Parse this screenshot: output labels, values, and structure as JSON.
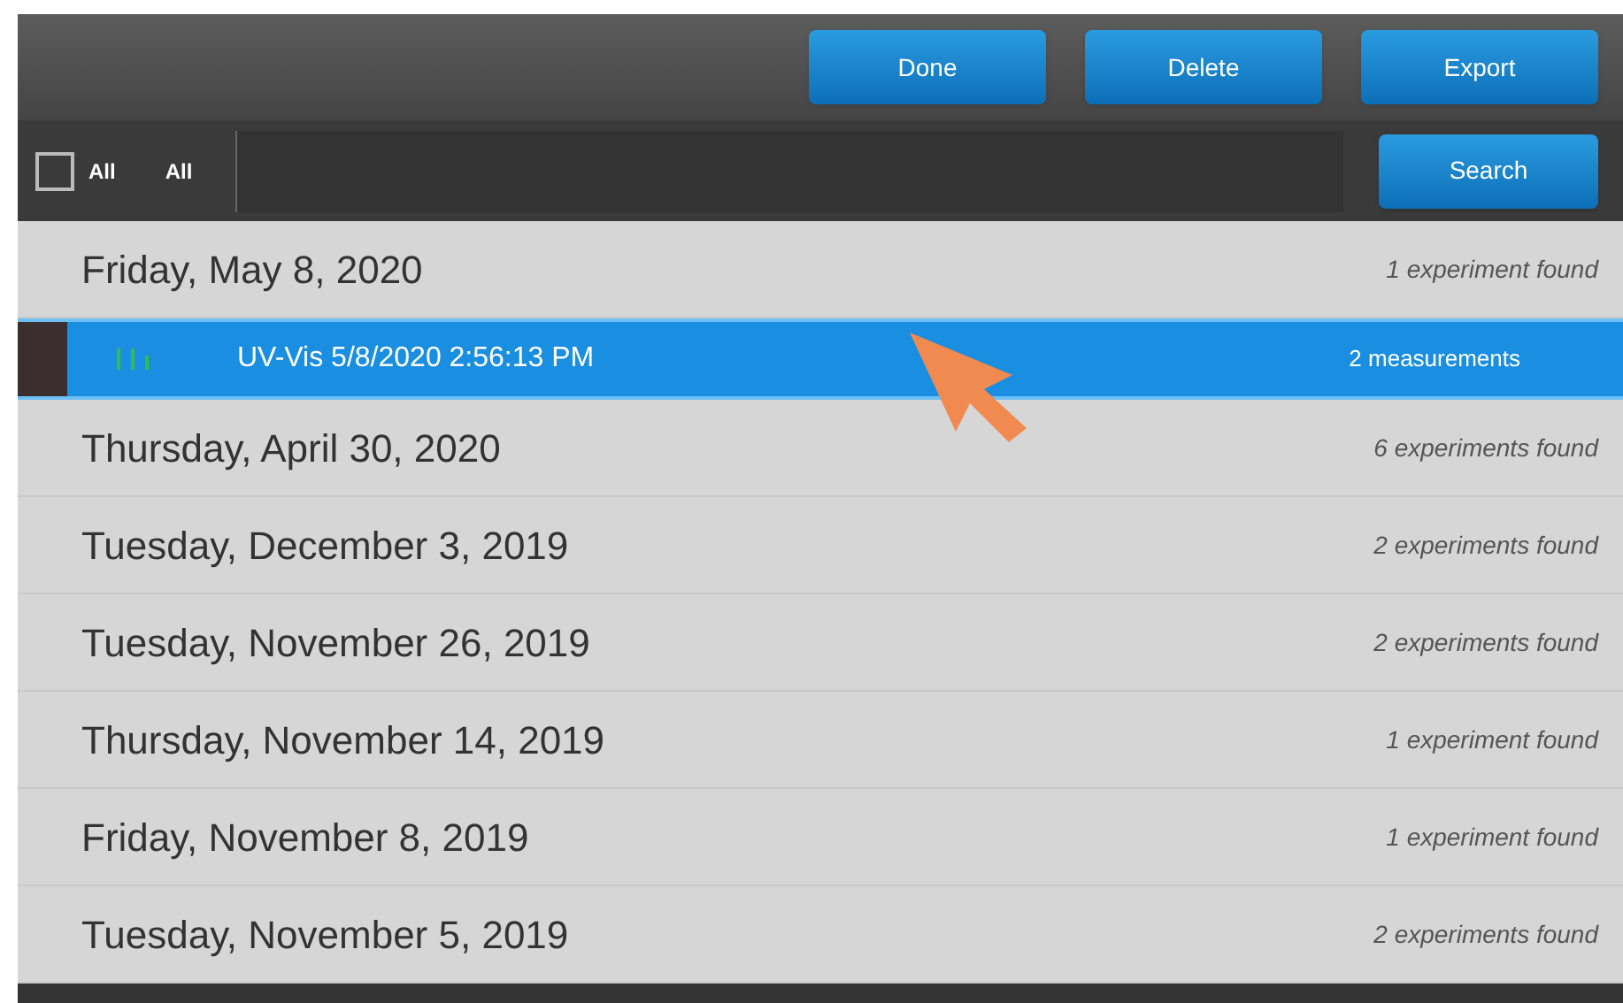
{
  "toolbar": {
    "buttons": [
      "Done",
      "Delete",
      "Export"
    ]
  },
  "filter": {
    "checkbox": {
      "label": "All",
      "checked": false
    },
    "scope_label": "All",
    "search_button": "Search"
  },
  "groups": [
    {
      "kind": "date",
      "title": "Friday, May 8, 2020",
      "count": "1 experiment found"
    },
    {
      "kind": "experiment",
      "title": "UV-Vis 5/8/2020 2:56:13 PM",
      "count": "2 measurements",
      "selected": true
    },
    {
      "kind": "date",
      "title": "Thursday, April 30, 2020",
      "count": "6 experiments found"
    },
    {
      "kind": "date",
      "title": "Tuesday, December 3, 2019",
      "count": "2 experiments found"
    },
    {
      "kind": "date",
      "title": "Tuesday, November 26, 2019",
      "count": "2 experiments found"
    },
    {
      "kind": "date",
      "title": "Thursday, November 14, 2019",
      "count": "1 experiment found"
    },
    {
      "kind": "date",
      "title": "Friday, November 8, 2019",
      "count": "1 experiment found"
    },
    {
      "kind": "date",
      "title": "Tuesday, November 5, 2019",
      "count": "2 experiments found"
    }
  ]
}
